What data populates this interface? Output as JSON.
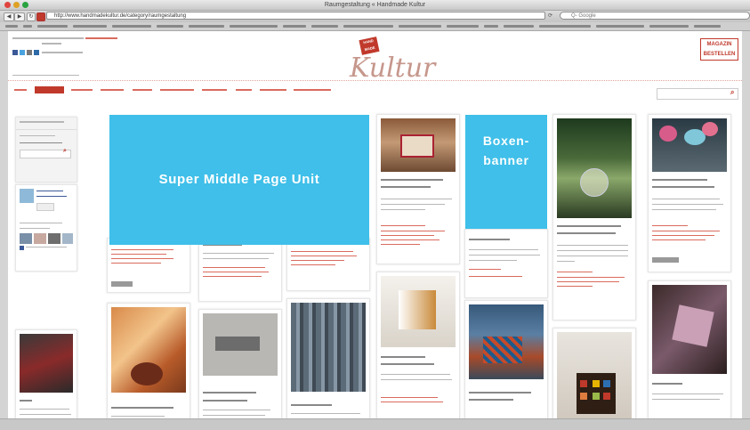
{
  "browser": {
    "window_title": "Raumgestaltung « Handmade Kultur",
    "back_label": "◀",
    "forward_label": "▶",
    "url": "http://www.handmadekultur.de/category/raumgestaltung",
    "search_placeholder": "Q- Google"
  },
  "site": {
    "logo_badge": "HAND MADE",
    "logo_text": "Kultur",
    "magazine_label": "MAGAZIN BESTELLEN"
  },
  "ads": {
    "middle": "Super Middle Page Unit",
    "box": "Boxen- banner"
  },
  "colors": {
    "accent": "#c0392b",
    "ad": "#3fbfe9"
  }
}
